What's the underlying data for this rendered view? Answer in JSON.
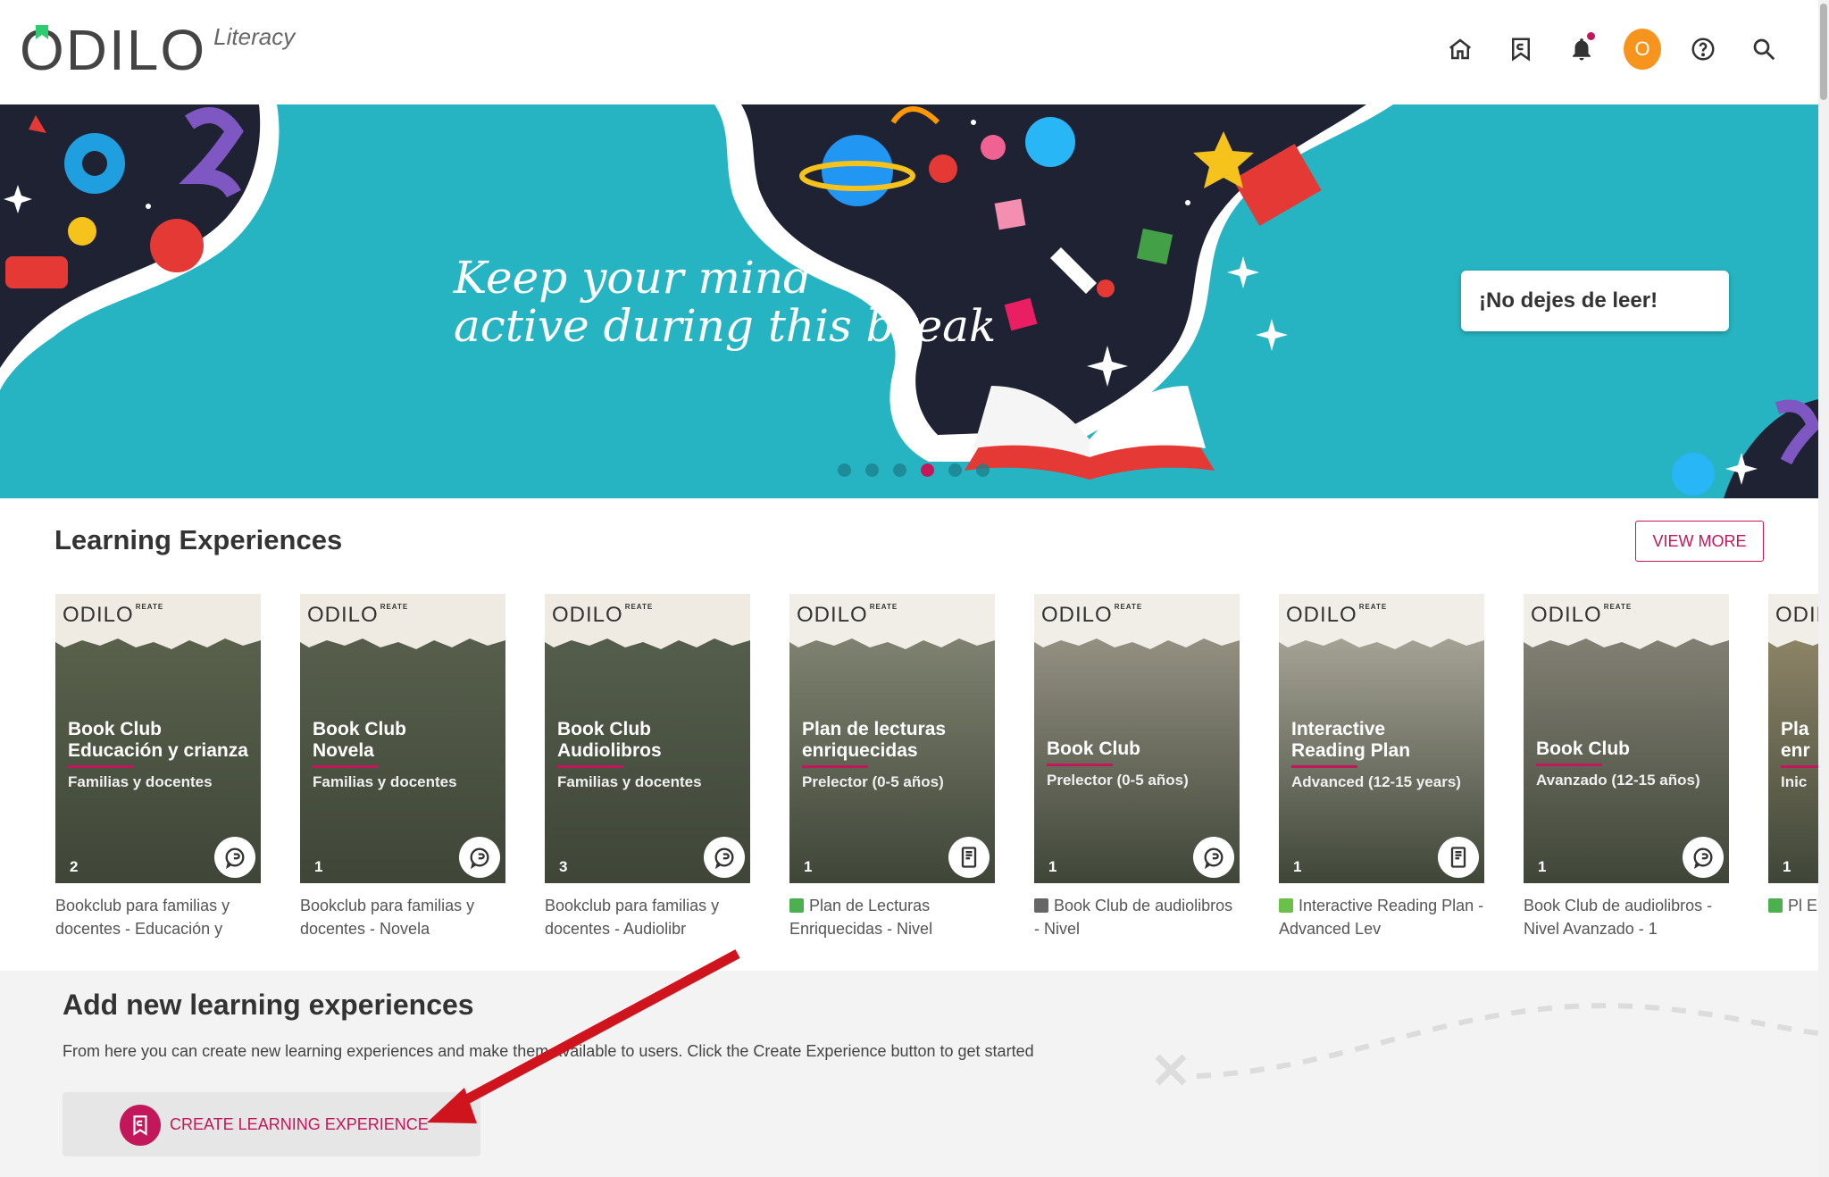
{
  "header": {
    "logo_text": "ODILO",
    "logo_sub": "Literacy",
    "avatar_initial": "O",
    "icons": [
      "home-icon",
      "bookmark-icon",
      "bell-icon",
      "help-icon",
      "search-icon"
    ]
  },
  "hero": {
    "headline": "Keep your mind\nactive during this break",
    "cta_label": "¡No dejes de leer!",
    "slides": 6,
    "active_slide": 4,
    "bg_color": "#27b4c2"
  },
  "learning": {
    "title": "Learning Experiences",
    "view_more": "VIEW MORE",
    "cards": [
      {
        "cover_title": "Book Club",
        "cover_title2": "Educación y crianza",
        "cover_sub": "Familias y docentes",
        "cover_sub_bold": "",
        "count": "2",
        "badge": "chat-icon",
        "caption": "Bookclub para familias y docentes - Educación y",
        "caption_icon": ""
      },
      {
        "cover_title": "Book Club",
        "cover_title2": "Novela",
        "cover_sub": "Familias y docentes",
        "cover_sub_bold": "",
        "count": "1",
        "badge": "chat-icon",
        "caption": "Bookclub para familias y docentes - Novela",
        "caption_icon": ""
      },
      {
        "cover_title": "Book Club",
        "cover_title2": "Audiolibros",
        "cover_sub": "Familias y docentes",
        "cover_sub_bold": "",
        "count": "3",
        "badge": "chat-icon",
        "caption": "Bookclub para familias y docentes - Audiolibr",
        "caption_icon": ""
      },
      {
        "cover_title": "Plan de lecturas",
        "cover_title2": "enriquecidas",
        "cover_sub": "(0-5 años)",
        "cover_sub_bold": "Prelector",
        "count": "1",
        "badge": "book-icon",
        "caption": "Plan de Lecturas Enriquecidas - Nivel",
        "caption_icon": "books"
      },
      {
        "cover_title": "Book Club",
        "cover_title2": "",
        "cover_sub": "(0-5 años)",
        "cover_sub_bold": "Prelector",
        "count": "1",
        "badge": "chat-icon",
        "caption": "Book Club de audiolibros - Nivel",
        "caption_icon": "headphones"
      },
      {
        "cover_title": "Interactive",
        "cover_title2": "Reading Plan",
        "cover_sub": "(12-15 years)",
        "cover_sub_bold": "Advanced",
        "count": "1",
        "badge": "book-icon",
        "caption": "Interactive Reading Plan - Advanced Lev",
        "caption_icon": "green-book"
      },
      {
        "cover_title": "Book Club",
        "cover_title2": "",
        "cover_sub": "(12-15 años)",
        "cover_sub_bold": "Avanzado",
        "count": "1",
        "badge": "chat-icon",
        "caption": "Book Club de audiolibros - Nivel Avanzado - 1",
        "caption_icon": ""
      },
      {
        "cover_title": "Pla",
        "cover_title2": "enr",
        "cover_sub": "",
        "cover_sub_bold": "Inic",
        "count": "1",
        "badge": "book-icon",
        "caption": "Pl Enriqu",
        "caption_icon": "books"
      }
    ]
  },
  "add": {
    "title": "Add new learning experiences",
    "description": "From here you can create new learning experiences and make them available to users. Click the Create Experience button to get started",
    "button_label": "CREATE LEARNING EXPERIENCE"
  },
  "colors": {
    "accent": "#c2185b",
    "avatar": "#f7941d",
    "arrow": "#d0141e"
  }
}
